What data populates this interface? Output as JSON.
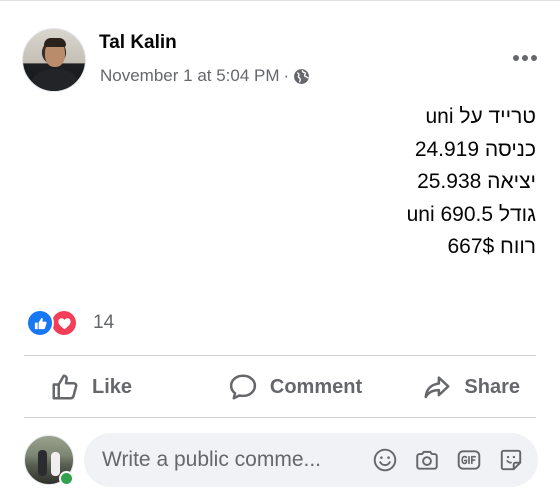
{
  "post": {
    "author": "Tal Kalin",
    "timestamp": "November 1 at 5:04 PM",
    "separator": "·",
    "audience_icon": "globe-icon",
    "more_icon": "more-options-icon",
    "lines": [
      "טרייד על uni",
      "כניסה 24.919",
      "יציאה 25.938",
      "גודל 690.5 uni",
      "רווח 667$"
    ]
  },
  "reactions": {
    "types": [
      "like",
      "love"
    ],
    "count": "14",
    "colors": {
      "like": "#1877f2",
      "love": "#f33e58"
    }
  },
  "actions": {
    "like": "Like",
    "comment": "Comment",
    "share": "Share"
  },
  "comment_box": {
    "placeholder": "Write a public comme...",
    "icons": [
      "emoji-icon",
      "camera-icon",
      "gif-icon",
      "sticker-icon"
    ]
  },
  "colors": {
    "text_primary": "#050505",
    "text_secondary": "#65676b",
    "input_bg": "#f0f2f5",
    "online": "#31a24c"
  }
}
